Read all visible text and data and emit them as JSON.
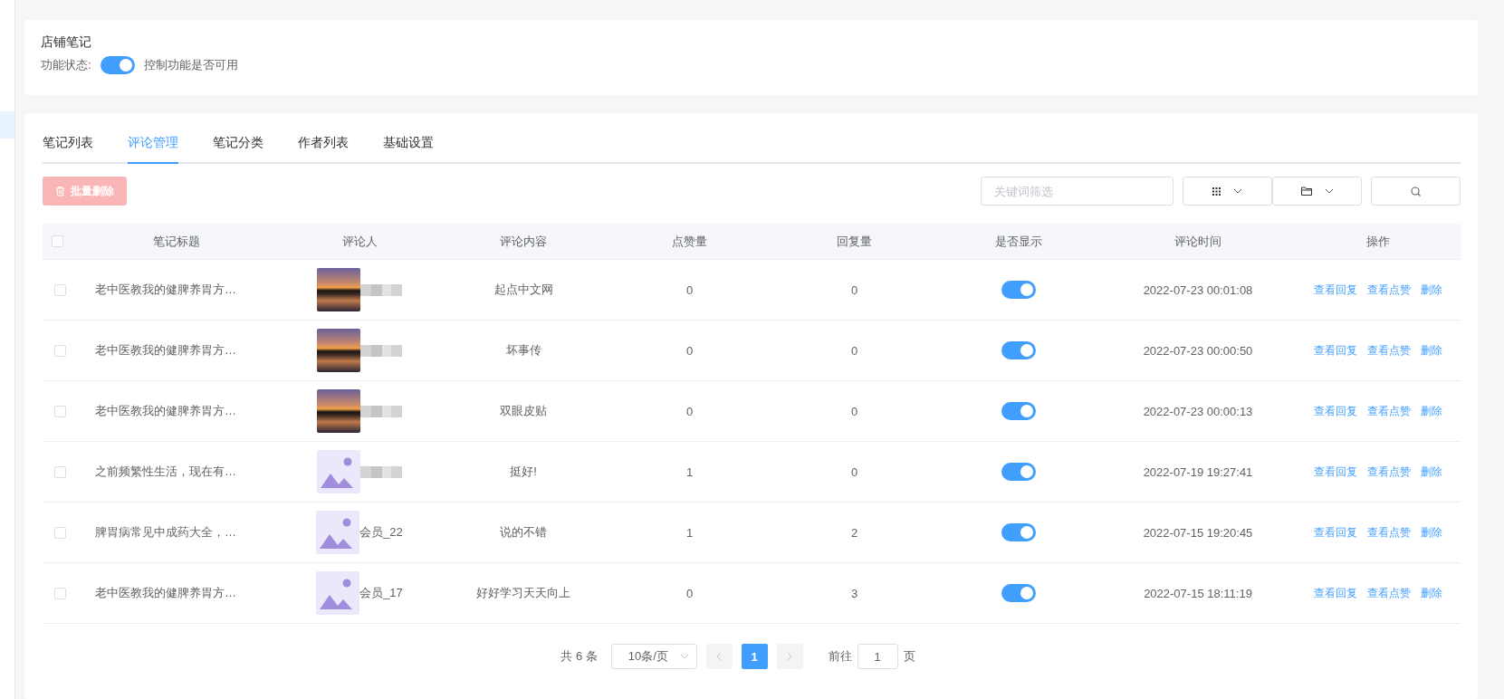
{
  "feature_card": {
    "title": "店铺笔记",
    "status_label": "功能状态:",
    "status_on": true,
    "status_hint": "控制功能是否可用"
  },
  "tabs": [
    {
      "label": "笔记列表",
      "selected": false
    },
    {
      "label": "评论管理",
      "selected": true
    },
    {
      "label": "笔记分类",
      "selected": false
    },
    {
      "label": "作者列表",
      "selected": false
    },
    {
      "label": "基础设置",
      "selected": false
    }
  ],
  "toolbar": {
    "batch_delete": "批量删除",
    "batch_delete_disabled": true,
    "keyword": {
      "placeholder": "关键词筛选"
    }
  },
  "table": {
    "select_all_checked": false,
    "columns": [
      "笔记标题",
      "评论人",
      "评论内容",
      "点赞量",
      "回复量",
      "是否显示",
      "评论时间",
      "操作"
    ],
    "rows": [
      {
        "checked": false,
        "title": "老中医教我的健脾养胃方…",
        "kind": "photo",
        "name_hidden": true,
        "content": "起点中文网",
        "likes": "0",
        "replies": "0",
        "shown": true,
        "time": "2022-07-23 00:01:08",
        "actions": [
          "查看回复",
          "查看点赞",
          "删除"
        ]
      },
      {
        "checked": false,
        "title": "老中医教我的健脾养胃方…",
        "kind": "photo",
        "name_hidden": true,
        "content": "坏事传",
        "likes": "0",
        "replies": "0",
        "shown": true,
        "time": "2022-07-23 00:00:50",
        "actions": [
          "查看回复",
          "查看点赞",
          "删除"
        ]
      },
      {
        "checked": false,
        "title": "老中医教我的健脾养胃方…",
        "kind": "photo",
        "name_hidden": true,
        "content": "双眼皮贴",
        "likes": "0",
        "replies": "0",
        "shown": true,
        "time": "2022-07-23 00:00:13",
        "actions": [
          "查看回复",
          "查看点赞",
          "删除"
        ]
      },
      {
        "checked": false,
        "title": "之前频繁性生活，现在有…",
        "kind": "default",
        "name_hidden": true,
        "content": "挺好!",
        "likes": "1",
        "replies": "0",
        "shown": true,
        "time": "2022-07-19 19:27:41",
        "actions": [
          "查看回复",
          "查看点赞",
          "删除"
        ]
      },
      {
        "checked": false,
        "title": "脾胃病常见中成药大全，…",
        "kind": "default",
        "name_hidden": false,
        "commenter": "会员_22",
        "content": "说的不错",
        "likes": "1",
        "replies": "2",
        "shown": true,
        "time": "2022-07-15 19:20:45",
        "actions": [
          "查看回复",
          "查看点赞",
          "删除"
        ]
      },
      {
        "checked": false,
        "title": "老中医教我的健脾养胃方…",
        "kind": "default",
        "name_hidden": false,
        "commenter": "会员_17",
        "content": "好好学习天天向上",
        "likes": "0",
        "replies": "3",
        "shown": true,
        "time": "2022-07-15 18:11:19",
        "actions": [
          "查看回复",
          "查看点赞",
          "删除"
        ]
      }
    ]
  },
  "pagination": {
    "total": "共 6 条",
    "page_size": "10条/页",
    "pages": [
      {
        "label": "1",
        "selected": true
      }
    ],
    "goto_label": "前往",
    "goto_value": "1",
    "page_unit": "页"
  }
}
